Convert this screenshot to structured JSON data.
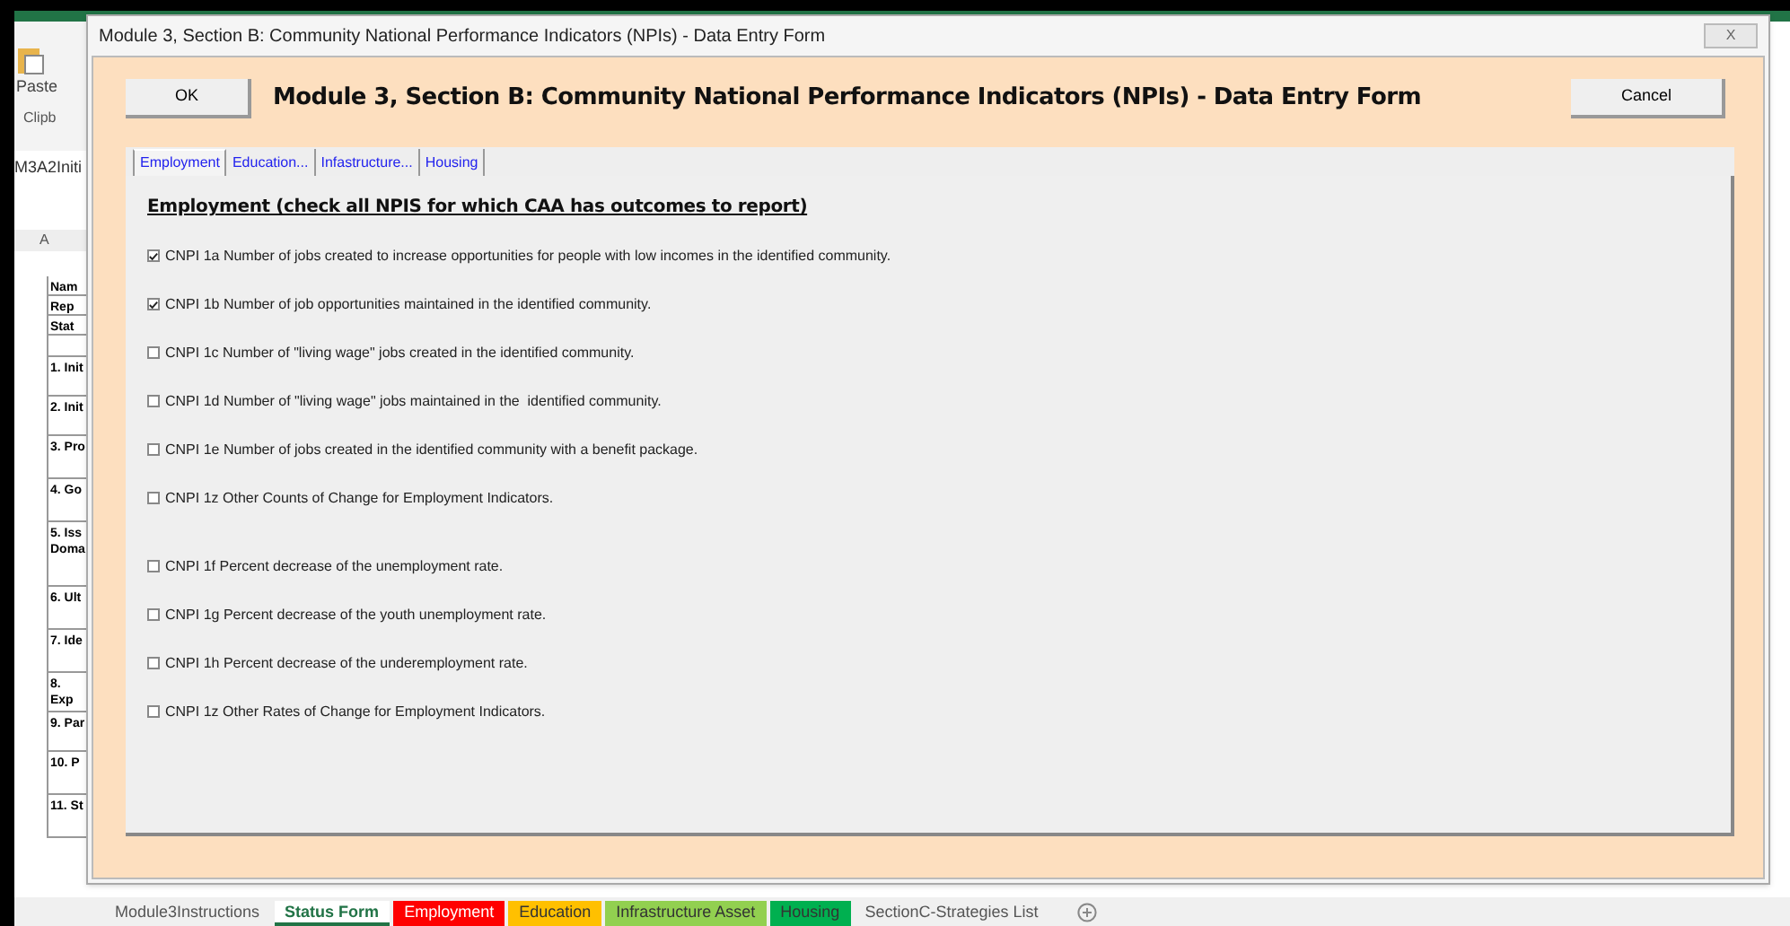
{
  "excel": {
    "ribbon": {
      "paste": "Paste",
      "group": "Clipb"
    },
    "name_box": "M3A2Initi",
    "column_header": "A",
    "cells": [
      {
        "text": "Nam",
        "kind": "short"
      },
      {
        "text": "Rep",
        "kind": "short"
      },
      {
        "text": "Stat",
        "kind": "short"
      },
      {
        "text": "",
        "kind": "blank"
      },
      {
        "text": "1. Init",
        "kind": "tall"
      },
      {
        "text": "2. Init",
        "kind": "tall"
      },
      {
        "text": "3. Pro",
        "kind": "taller"
      },
      {
        "text": "4. Go",
        "kind": "taller"
      },
      {
        "text": "5. Iss\nDoma",
        "kind": "huge"
      },
      {
        "text": "6. Ult",
        "kind": "taller"
      },
      {
        "text": "7. Ide",
        "kind": "taller"
      },
      {
        "text": "8. Exp",
        "kind": "tall"
      },
      {
        "text": "9. Par",
        "kind": "tall"
      },
      {
        "text": "10. P",
        "kind": "taller"
      },
      {
        "text": "11. St",
        "kind": "taller"
      }
    ],
    "sheet_tabs": [
      {
        "label": "Module3Instructions",
        "selected": false
      },
      {
        "label": "Status Form",
        "selected": true
      },
      {
        "label": "Employment",
        "selected": false,
        "color": "#ff0000"
      },
      {
        "label": "Education",
        "selected": false,
        "color": "#ffc000"
      },
      {
        "label": "Infrastructure Asset",
        "selected": false,
        "color": "#92d050"
      },
      {
        "label": "Housing",
        "selected": false,
        "color": "#00b050"
      },
      {
        "label": "SectionC-Strategies List",
        "selected": false
      }
    ]
  },
  "dialog": {
    "title": "Module 3, Section B: Community National Performance Indicators (NPIs) - Data Entry Form",
    "close": "X",
    "ok": "OK",
    "heading": "Module 3, Section B: Community National Performance Indicators (NPIs) - Data Entry Form",
    "cancel": "Cancel",
    "tabs": [
      {
        "label": "Employment",
        "selected": true
      },
      {
        "label": "Education...",
        "selected": false
      },
      {
        "label": "Infastructure...",
        "selected": false
      },
      {
        "label": "Housing",
        "selected": false
      }
    ],
    "section_title": "Employment (check all NPIS for which CAA has outcomes to report)",
    "groups": [
      [
        {
          "label": "CNPI 1a Number of jobs created to increase opportunities for people with low incomes in the identified community.",
          "checked": true
        },
        {
          "label": "CNPI 1b Number of job opportunities maintained in the identified community.",
          "checked": true
        },
        {
          "label": "CNPI 1c Number of \"living wage\" jobs created in the identified community.",
          "checked": false
        },
        {
          "label": "CNPI 1d Number of \"living wage\" jobs maintained in the  identified community.",
          "checked": false
        },
        {
          "label": "CNPI 1e Number of jobs created in the identified community with a benefit package.",
          "checked": false
        },
        {
          "label": "CNPI 1z Other Counts of Change for Employment Indicators.",
          "checked": false
        }
      ],
      [
        {
          "label": "CNPI 1f Percent decrease of the unemployment rate.",
          "checked": false
        },
        {
          "label": "CNPI 1g Percent decrease of the youth unemployment rate.",
          "checked": false
        },
        {
          "label": "CNPI 1h Percent decrease of the underemployment rate.",
          "checked": false
        },
        {
          "label": "CNPI 1z Other Rates of Change for Employment Indicators.",
          "checked": false
        }
      ]
    ]
  }
}
